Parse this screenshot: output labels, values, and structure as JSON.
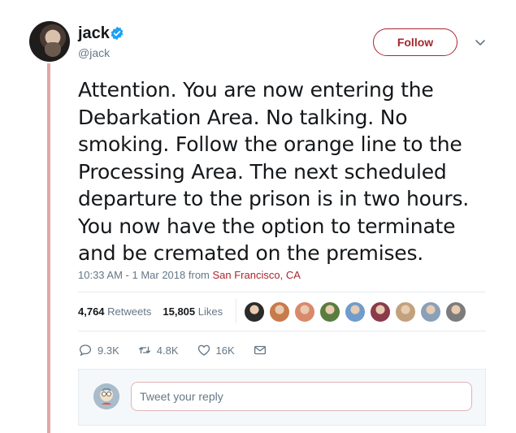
{
  "author": {
    "name": "jack",
    "handle": "@jack",
    "verified": true
  },
  "header": {
    "follow_label": "Follow"
  },
  "tweet": {
    "text": "Attention. You are now entering the Debarkation Area. No talking. No smoking. Follow the orange line to the Processing Area. The next scheduled departure to the prison is in two hours. You now have the option to terminate and be cremated on the premises.",
    "timestamp": "10:33 AM - 1 Mar 2018",
    "from_label": "from",
    "location": "San Francisco, CA"
  },
  "stats": {
    "retweets_count": "4,764",
    "retweets_label": "Retweets",
    "likes_count": "15,805",
    "likes_label": "Likes"
  },
  "likers": [
    "#2b2b2b",
    "#c77b4b",
    "#d98a6a",
    "#5a7d3f",
    "#6f9ccc",
    "#8a3b4a",
    "#c2a27c",
    "#8aa0b8",
    "#7c7c7c"
  ],
  "actions": {
    "replies": "9.3K",
    "retweets": "4.8K",
    "likes": "16K"
  },
  "reply": {
    "placeholder": "Tweet your reply"
  },
  "colors": {
    "accent": "#a8262f",
    "thread_line": "#e3a5a9",
    "verified": "#1da1f2",
    "muted": "#657786"
  }
}
